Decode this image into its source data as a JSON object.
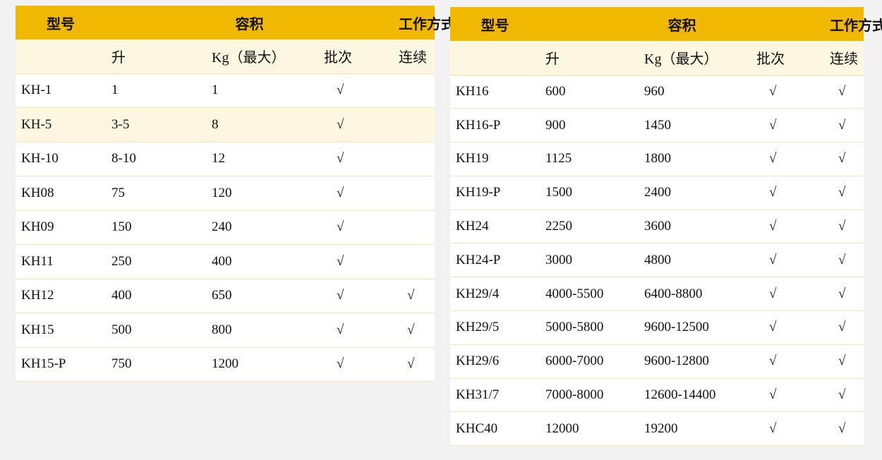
{
  "headers": {
    "model": "型号",
    "capacity": "容积",
    "mode": "工作方式",
    "liters": "升",
    "kg": "Kg（最大）",
    "batch": "批次",
    "continuous": "连续"
  },
  "check_symbol": "√",
  "left_table": {
    "highlighted_row": 1,
    "rows": [
      {
        "model": "KH-1",
        "liters": "1",
        "kg": "1",
        "batch": "√",
        "continuous": ""
      },
      {
        "model": "KH-5",
        "liters": "3-5",
        "kg": "8",
        "batch": "√",
        "continuous": ""
      },
      {
        "model": "KH-10",
        "liters": "8-10",
        "kg": "12",
        "batch": "√",
        "continuous": ""
      },
      {
        "model": "KH08",
        "liters": "75",
        "kg": "120",
        "batch": "√",
        "continuous": ""
      },
      {
        "model": "KH09",
        "liters": "150",
        "kg": "240",
        "batch": "√",
        "continuous": ""
      },
      {
        "model": "KH11",
        "liters": "250",
        "kg": "400",
        "batch": "√",
        "continuous": ""
      },
      {
        "model": "KH12",
        "liters": "400",
        "kg": "650",
        "batch": "√",
        "continuous": "√"
      },
      {
        "model": "KH15",
        "liters": "500",
        "kg": "800",
        "batch": "√",
        "continuous": "√"
      },
      {
        "model": "KH15-P",
        "liters": "750",
        "kg": "1200",
        "batch": "√",
        "continuous": "√"
      }
    ]
  },
  "right_table": {
    "rows": [
      {
        "model": "KH16",
        "liters": "600",
        "kg": "960",
        "batch": "√",
        "continuous": "√"
      },
      {
        "model": "KH16-P",
        "liters": "900",
        "kg": "1450",
        "batch": "√",
        "continuous": "√"
      },
      {
        "model": "KH19",
        "liters": "1125",
        "kg": "1800",
        "batch": "√",
        "continuous": "√"
      },
      {
        "model": "KH19-P",
        "liters": "1500",
        "kg": "2400",
        "batch": "√",
        "continuous": "√"
      },
      {
        "model": "KH24",
        "liters": "2250",
        "kg": "3600",
        "batch": "√",
        "continuous": "√"
      },
      {
        "model": "KH24-P",
        "liters": "3000",
        "kg": "4800",
        "batch": "√",
        "continuous": "√"
      },
      {
        "model": "KH29/4",
        "liters": "4000-5500",
        "kg": "6400-8800",
        "batch": "√",
        "continuous": "√"
      },
      {
        "model": "KH29/5",
        "liters": "5000-5800",
        "kg": "9600-12500",
        "batch": "√",
        "continuous": "√"
      },
      {
        "model": "KH29/6",
        "liters": "6000-7000",
        "kg": "9600-12800",
        "batch": "√",
        "continuous": "√"
      },
      {
        "model": "KH31/7",
        "liters": "7000-8000",
        "kg": "12600-14400",
        "batch": "√",
        "continuous": "√"
      },
      {
        "model": "KHC40",
        "liters": "12000",
        "kg": "19200",
        "batch": "√",
        "continuous": "√"
      }
    ]
  },
  "colors": {
    "header": "#f0b800",
    "subheader": "#fdf6e0",
    "background": "#f2f2f2"
  }
}
